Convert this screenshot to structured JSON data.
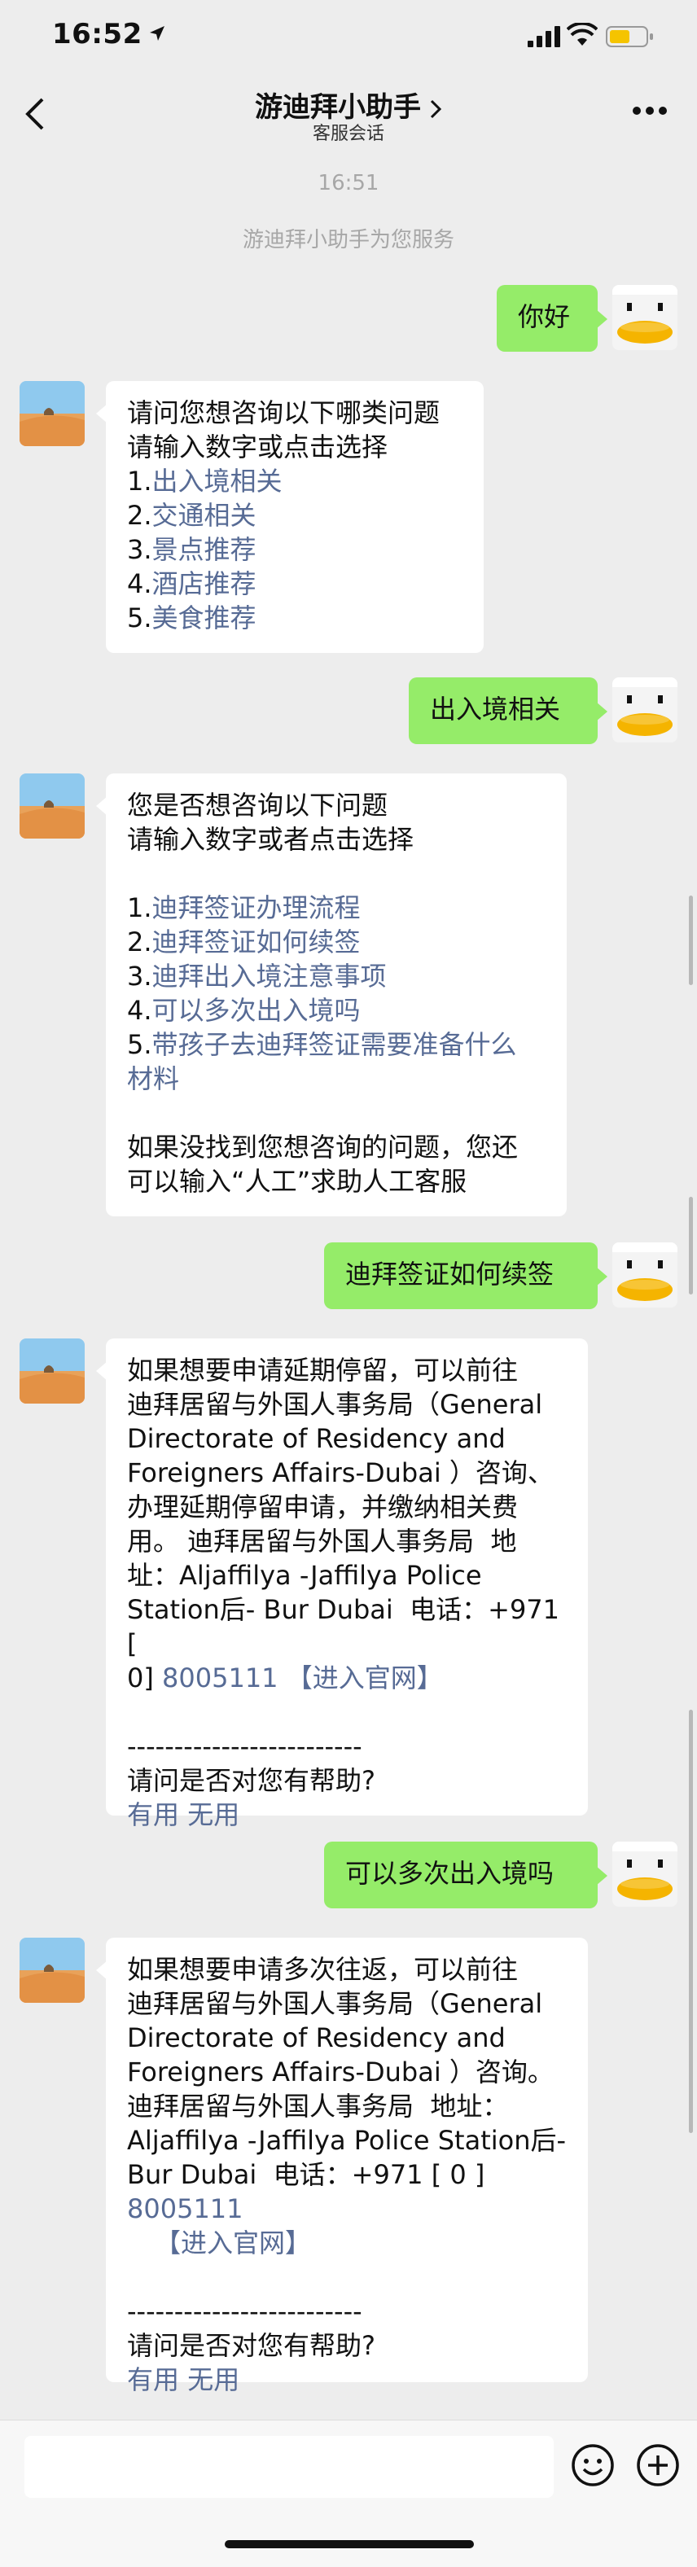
{
  "status_bar": {
    "time": "16:52"
  },
  "nav": {
    "title": "游迪拜小助手",
    "subtitle": "客服会话"
  },
  "system": {
    "timestamp": "16:51",
    "service_notice": "游迪拜小助手为您服务"
  },
  "messages": {
    "m1": {
      "text": "你好"
    },
    "m2": {
      "lines": [
        "请问您想咨询以下哪类问题",
        "请输入数字或点击选择"
      ],
      "options": [
        {
          "num": "1.",
          "label": "出入境相关"
        },
        {
          "num": "2.",
          "label": "交通相关"
        },
        {
          "num": "3.",
          "label": "景点推荐"
        },
        {
          "num": "4.",
          "label": "酒店推荐"
        },
        {
          "num": "5.",
          "label": "美食推荐"
        }
      ]
    },
    "m3": {
      "text": "出入境相关"
    },
    "m4": {
      "lines": [
        "您是否想咨询以下问题",
        "请输入数字或者点击选择"
      ],
      "options": [
        {
          "num": "1.",
          "label": "迪拜签证办理流程"
        },
        {
          "num": "2.",
          "label": "迪拜签证如何续签"
        },
        {
          "num": "3.",
          "label": "迪拜出入境注意事项"
        },
        {
          "num": "4.",
          "label": "可以多次出入境吗"
        },
        {
          "num": "5.",
          "label": "带孩子去迪拜签证需要准备什么",
          "label2": "材料"
        }
      ],
      "footer1": "如果没找到您想咨询的问题，您还",
      "footer2": "可以输入“人工”求助人工客服"
    },
    "m5": {
      "text": "迪拜签证如何续签"
    },
    "m6": {
      "lines": [
        "如果想要申请延期停留，可以前往",
        "迪拜居留与外国人事务局（General",
        "Directorate of Residency and",
        "Foreigners Affairs-Dubai ）咨询、",
        "办理延期停留申请，并缴纳相关费",
        "用。 迪拜居留与外国人事务局  地",
        "址：Aljaffilya -Jaffilya Police",
        "Station后- Bur Dubai  电话：+971 ["
      ],
      "phone_prefix": "0] ",
      "phone": "8005111",
      "site_link": "【进入官网】",
      "divider": "-------------------------",
      "question": "请问是否对您有帮助?",
      "useful": "有用",
      "useless": "无用"
    },
    "m7": {
      "text": "可以多次出入境吗"
    },
    "m8": {
      "lines": [
        "如果想要申请多次往返，可以前往",
        "迪拜居留与外国人事务局（General",
        "Directorate of Residency and",
        "Foreigners Affairs-Dubai ）咨询。",
        "迪拜居留与外国人事务局  地址：",
        "Aljaffilya -Jaffilya Police Station后-"
      ],
      "line7_prefix": "Bur Dubai  电话：+971 [ 0 ] ",
      "phone": "8005111",
      "site_link": "【进入官网】",
      "divider": "-------------------------",
      "question": "请问是否对您有帮助?",
      "useful": "有用",
      "useless": "无用"
    }
  },
  "input": {
    "placeholder": ""
  },
  "colors": {
    "background": "#ededed",
    "my_bubble": "#95ec69",
    "bot_bubble": "#ffffff",
    "link": "#576b95"
  }
}
